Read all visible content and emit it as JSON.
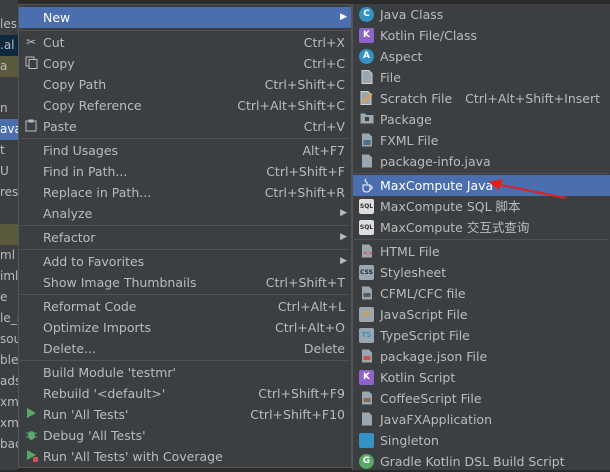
{
  "tree": [
    {
      "text": "les"
    },
    {
      "text": ".al"
    },
    {
      "text": "a"
    },
    {
      "text": ""
    },
    {
      "text": "n"
    },
    {
      "text": "ava"
    },
    {
      "text": "t"
    },
    {
      "text": "U"
    },
    {
      "text": "reso"
    },
    {
      "text": ""
    },
    {
      "text": ""
    },
    {
      "text": "ml"
    },
    {
      "text": "iml"
    },
    {
      "text": "e"
    },
    {
      "text": "le_r"
    },
    {
      "text": "sou"
    },
    {
      "text": "ble"
    },
    {
      "text": "ads"
    },
    {
      "text": "xme"
    },
    {
      "text": "xme"
    },
    {
      "text": "bac"
    }
  ],
  "menu": {
    "new": {
      "label": "New"
    },
    "cut": {
      "label": "Cut",
      "shortcut": "Ctrl+X"
    },
    "copy": {
      "label": "Copy",
      "shortcut": "Ctrl+C"
    },
    "copy_path": {
      "label": "Copy Path",
      "shortcut": "Ctrl+Shift+C"
    },
    "copy_reference": {
      "label": "Copy Reference",
      "shortcut": "Ctrl+Alt+Shift+C"
    },
    "paste": {
      "label": "Paste",
      "shortcut": "Ctrl+V"
    },
    "find_usages": {
      "label": "Find Usages",
      "shortcut": "Alt+F7"
    },
    "find_in_path": {
      "label": "Find in Path...",
      "shortcut": "Ctrl+Shift+F"
    },
    "replace_in_path": {
      "label": "Replace in Path...",
      "shortcut": "Ctrl+Shift+R"
    },
    "analyze": {
      "label": "Analyze"
    },
    "refactor": {
      "label": "Refactor"
    },
    "add_to_favorites": {
      "label": "Add to Favorites"
    },
    "show_image_thumbnails": {
      "label": "Show Image Thumbnails",
      "shortcut": "Ctrl+Shift+T"
    },
    "reformat_code": {
      "label": "Reformat Code",
      "shortcut": "Ctrl+Alt+L"
    },
    "optimize_imports": {
      "label": "Optimize Imports",
      "shortcut": "Ctrl+Alt+O"
    },
    "delete": {
      "label": "Delete...",
      "shortcut": "Delete"
    },
    "build_module": {
      "label": "Build Module 'testmr'"
    },
    "rebuild": {
      "label": "Rebuild '<default>'",
      "shortcut": "Ctrl+Shift+F9"
    },
    "run_all_tests": {
      "label": "Run 'All Tests'",
      "shortcut": "Ctrl+Shift+F10"
    },
    "debug_all_tests": {
      "label": "Debug 'All Tests'"
    },
    "run_with_coverage": {
      "label": "Run 'All Tests' with Coverage"
    }
  },
  "submenu": [
    {
      "label": "Java Class",
      "icon": "C",
      "shortcut": ""
    },
    {
      "label": "Kotlin File/Class",
      "icon": "K",
      "shortcut": ""
    },
    {
      "label": "Aspect",
      "icon": "A",
      "shortcut": ""
    },
    {
      "label": "File",
      "icon": "",
      "shortcut": ""
    },
    {
      "label": "Scratch File",
      "icon": "",
      "shortcut": "Ctrl+Alt+Shift+Insert"
    },
    {
      "label": "Package",
      "icon": "",
      "shortcut": ""
    },
    {
      "label": "FXML File",
      "icon": "",
      "shortcut": ""
    },
    {
      "label": "package-info.java",
      "icon": "",
      "shortcut": ""
    },
    {
      "label": "MaxCompute Java",
      "icon": "",
      "shortcut": ""
    },
    {
      "label": "MaxCompute SQL 脚本",
      "icon": "SQL",
      "shortcut": ""
    },
    {
      "label": "MaxCompute 交互式查询",
      "icon": "SQL",
      "shortcut": ""
    },
    {
      "label": "HTML File",
      "icon": "",
      "shortcut": ""
    },
    {
      "label": "Stylesheet",
      "icon": "CSS",
      "shortcut": ""
    },
    {
      "label": "CFML/CFC file",
      "icon": "",
      "shortcut": ""
    },
    {
      "label": "JavaScript File",
      "icon": "JS",
      "shortcut": ""
    },
    {
      "label": "TypeScript File",
      "icon": "TS",
      "shortcut": ""
    },
    {
      "label": "package.json File",
      "icon": "",
      "shortcut": ""
    },
    {
      "label": "Kotlin Script",
      "icon": "K",
      "shortcut": ""
    },
    {
      "label": "CoffeeScript File",
      "icon": "",
      "shortcut": ""
    },
    {
      "label": "JavaFXApplication",
      "icon": "",
      "shortcut": ""
    },
    {
      "label": "Singleton",
      "icon": "",
      "shortcut": ""
    },
    {
      "label": "Gradle Kotlin DSL Build Script",
      "icon": "G",
      "shortcut": ""
    }
  ],
  "colors": {
    "menu_bg": "#3c3f41",
    "highlight": "#4b6eaf",
    "annotation_arrow": "#e02020"
  }
}
